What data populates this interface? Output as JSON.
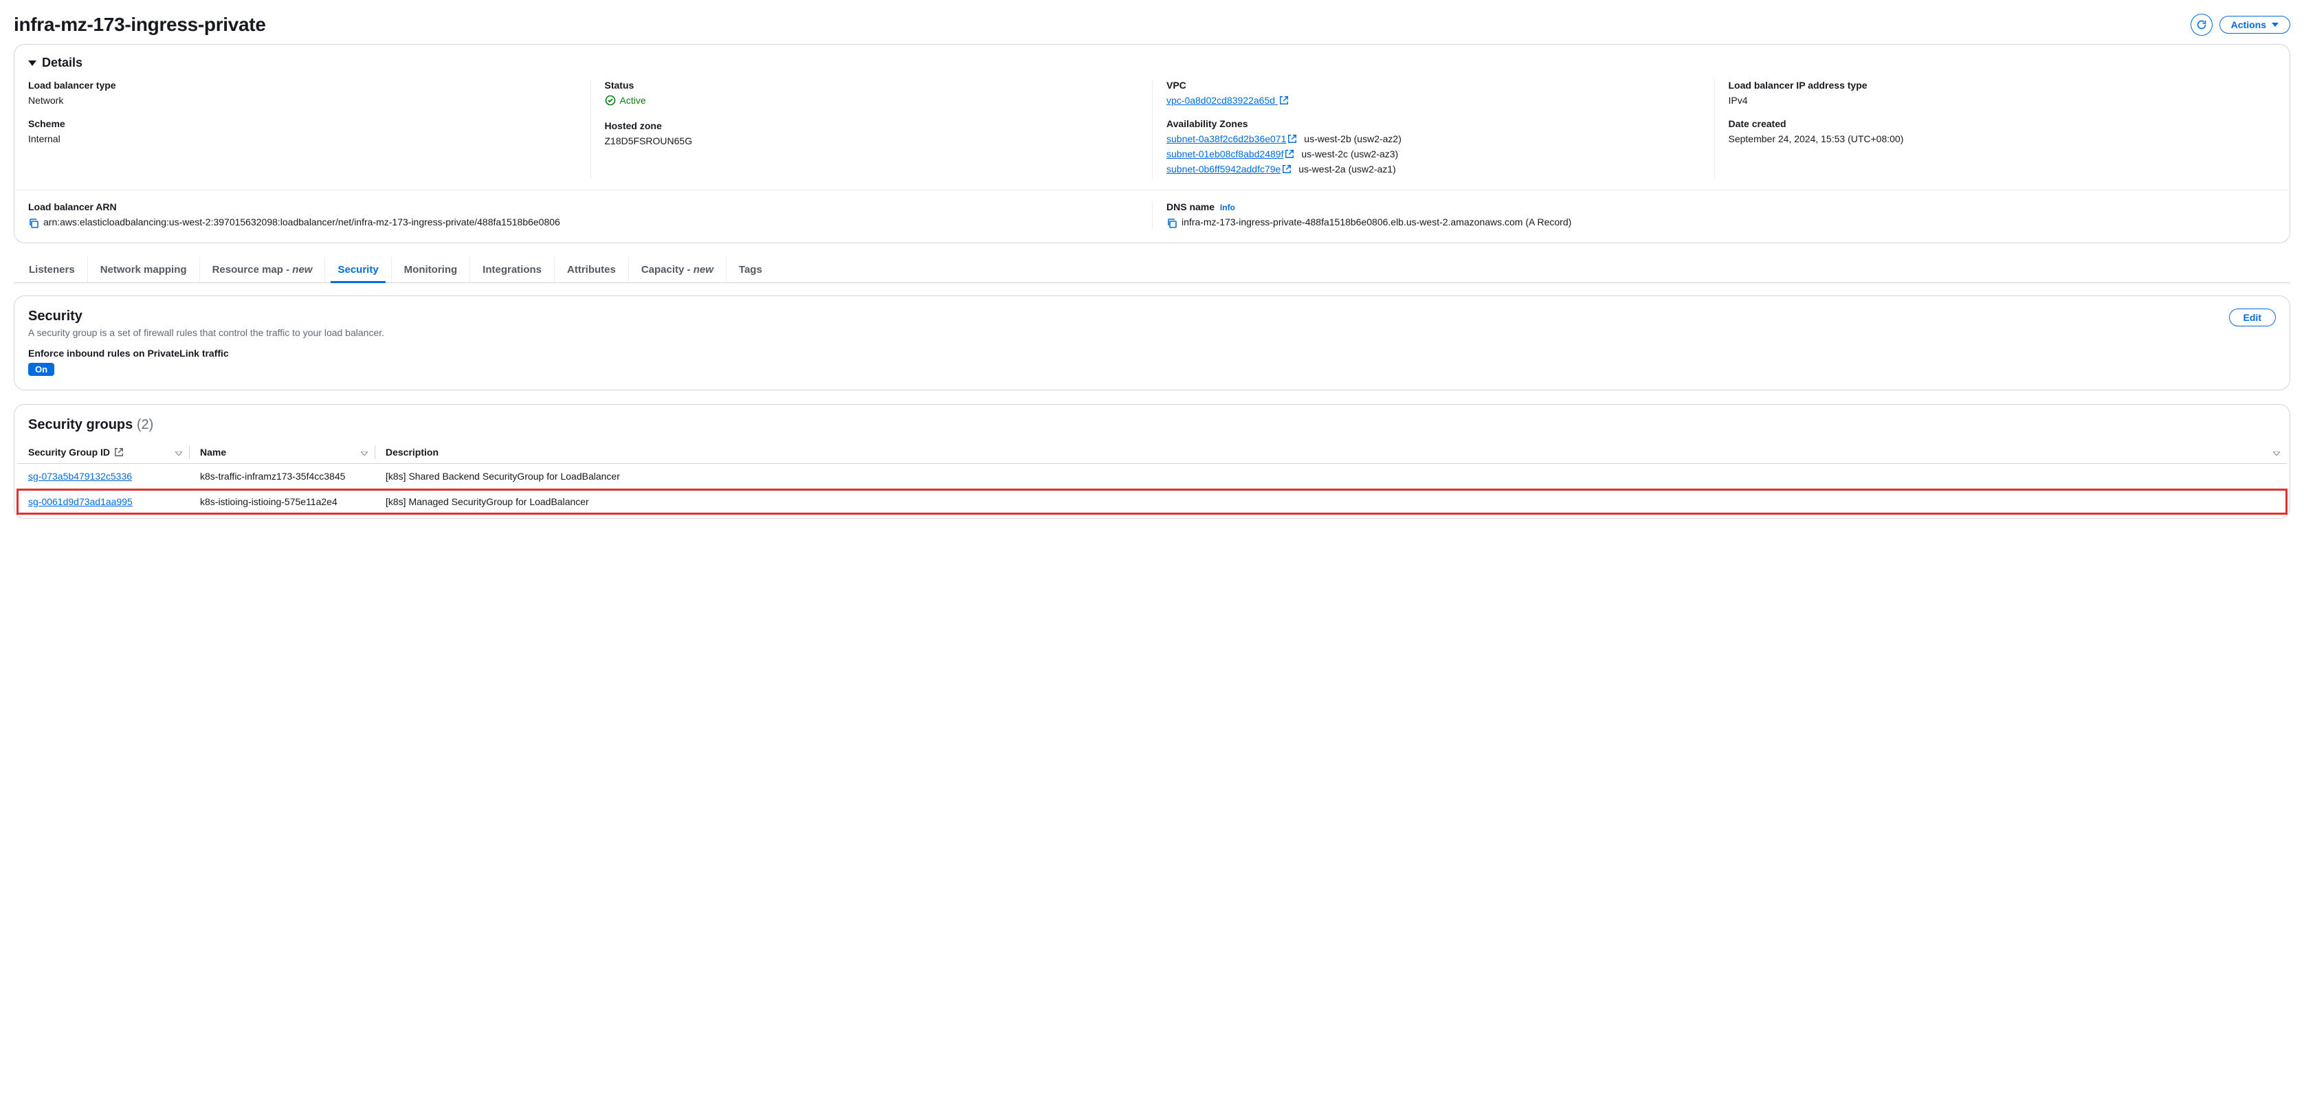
{
  "header": {
    "title": "infra-mz-173-ingress-private",
    "actions_label": "Actions"
  },
  "details": {
    "section_title": "Details",
    "type_label": "Load balancer type",
    "type_value": "Network",
    "scheme_label": "Scheme",
    "scheme_value": "Internal",
    "status_label": "Status",
    "status_value": "Active",
    "hosted_zone_label": "Hosted zone",
    "hosted_zone_value": "Z18D5FSROUN65G",
    "vpc_label": "VPC",
    "vpc_link": "vpc-0a8d02cd83922a65d",
    "az_label": "Availability Zones",
    "azs": [
      {
        "subnet": "subnet-0a38f2c6d2b36e071",
        "zone": "us-west-2b (usw2-az2)"
      },
      {
        "subnet": "subnet-01eb08cf8abd2489f",
        "zone": "us-west-2c (usw2-az3)"
      },
      {
        "subnet": "subnet-0b6ff5942addfc79e",
        "zone": "us-west-2a (usw2-az1)"
      }
    ],
    "ip_type_label": "Load balancer IP address type",
    "ip_type_value": "IPv4",
    "date_created_label": "Date created",
    "date_created_value": "September 24, 2024, 15:53 (UTC+08:00)",
    "arn_label": "Load balancer ARN",
    "arn_value": "arn:aws:elasticloadbalancing:us-west-2:397015632098:loadbalancer/net/infra-mz-173-ingress-private/488fa1518b6e0806",
    "dns_label": "DNS name",
    "dns_info": "Info",
    "dns_value": "infra-mz-173-ingress-private-488fa1518b6e0806.elb.us-west-2.amazonaws.com (A Record)"
  },
  "tabs": {
    "listeners": "Listeners",
    "network_mapping": "Network mapping",
    "resource_map": "Resource map - ",
    "resource_map_new": "new",
    "security": "Security",
    "monitoring": "Monitoring",
    "integrations": "Integrations",
    "attributes": "Attributes",
    "capacity": "Capacity - ",
    "capacity_new": "new",
    "tags": "Tags"
  },
  "security": {
    "title": "Security",
    "description": "A security group is a set of firewall rules that control the traffic to your load balancer.",
    "edit_label": "Edit",
    "enforce_label": "Enforce inbound rules on PrivateLink traffic",
    "enforce_value": "On"
  },
  "security_groups": {
    "title": "Security groups",
    "count": "(2)",
    "headers": {
      "id": "Security Group ID",
      "name": "Name",
      "description": "Description"
    },
    "rows": [
      {
        "id": "sg-073a5b479132c5336",
        "name": "k8s-traffic-inframz173-35f4cc3845",
        "description": "[k8s] Shared Backend SecurityGroup for LoadBalancer",
        "highlight": false
      },
      {
        "id": "sg-0061d9d73ad1aa995",
        "name": "k8s-istioing-istioing-575e11a2e4",
        "description": "[k8s] Managed SecurityGroup for LoadBalancer",
        "highlight": true
      }
    ]
  }
}
